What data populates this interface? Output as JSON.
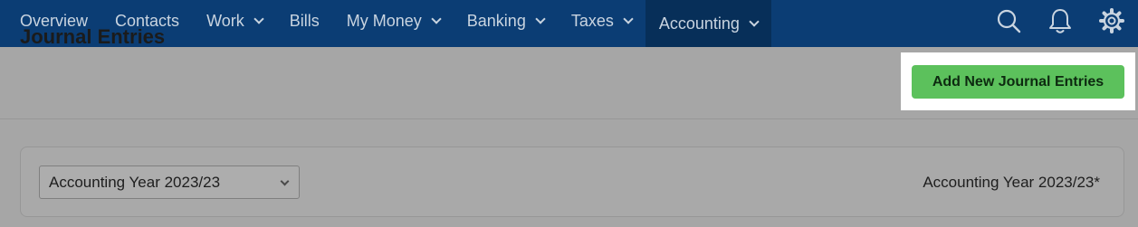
{
  "nav": {
    "items": [
      {
        "label": "Overview",
        "dropdown": false
      },
      {
        "label": "Contacts",
        "dropdown": false
      },
      {
        "label": "Work",
        "dropdown": true
      },
      {
        "label": "Bills",
        "dropdown": false
      },
      {
        "label": "My Money",
        "dropdown": true
      },
      {
        "label": "Banking",
        "dropdown": true
      },
      {
        "label": "Taxes",
        "dropdown": true
      },
      {
        "label": "Accounting",
        "dropdown": true,
        "active": true
      }
    ],
    "icons": [
      "search-icon",
      "bell-icon",
      "gear-icon"
    ]
  },
  "page": {
    "title": "Journal Entries",
    "add_button": "Add New Journal Entries"
  },
  "filter": {
    "selected_year": "Accounting Year 2023/23",
    "year_display": "Accounting Year 2023/23*"
  },
  "colors": {
    "nav_bg": "#0b3d74",
    "nav_active_bg": "#072f59",
    "button_green": "#5cc15c",
    "overlay_gray": "#a6a6a6"
  }
}
